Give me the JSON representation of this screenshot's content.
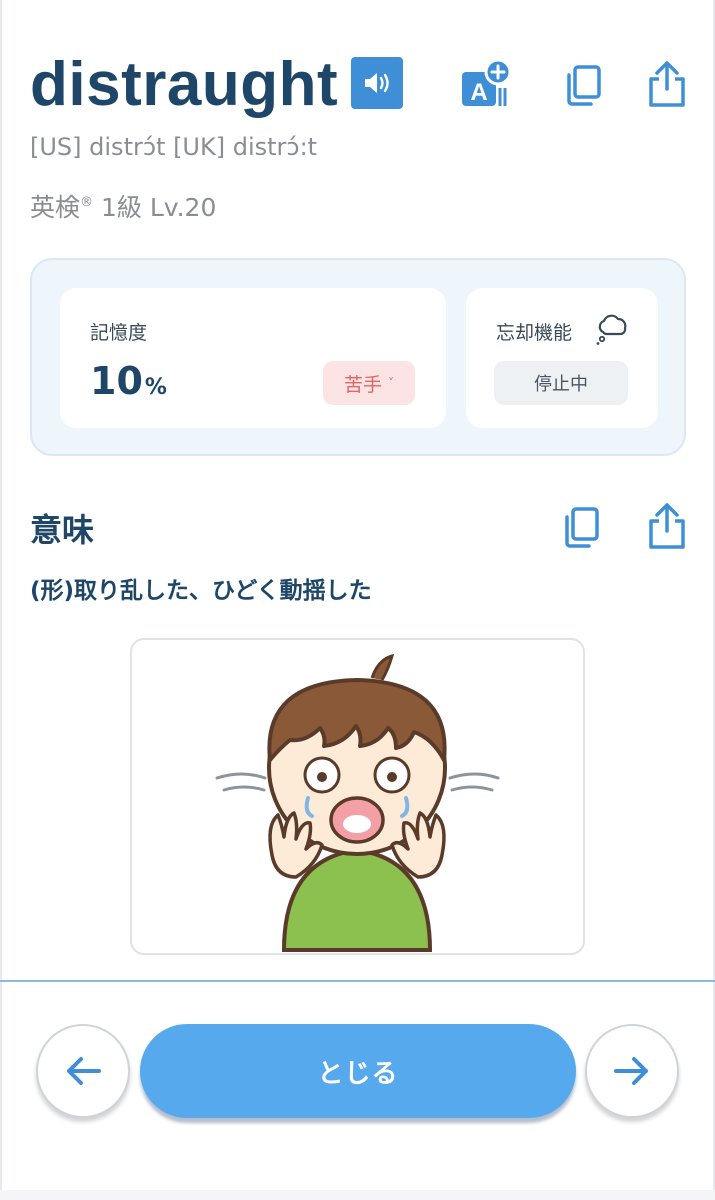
{
  "header": {
    "word": "distraught",
    "pronunciation": "[US] distrɔ́t [UK] distrɔ́:t",
    "level_prefix": "英検",
    "level_mark": "®",
    "level_rest": " 1級 Lv.20"
  },
  "memory": {
    "label": "記憶度",
    "value": "10",
    "unit": "%",
    "status_label": "苦手",
    "status_chevron": "˅"
  },
  "forget": {
    "label": "忘却機能",
    "status": "停止中"
  },
  "meaning": {
    "title": "意味",
    "definition": "(形)取り乱した、ひどく動揺した"
  },
  "footer": {
    "close_label": "とじる"
  },
  "colors": {
    "accent": "#3f8fd6",
    "button": "#56a9ec",
    "word": "#1e4668",
    "weak_bg": "#fde4e4",
    "weak_text": "#e06565"
  },
  "icons": {
    "speaker": "speaker-icon",
    "translate": "translate-add-icon",
    "copy": "copy-icon",
    "share": "share-icon",
    "cloud": "thought-cloud-icon",
    "prev": "arrow-left-icon",
    "next": "arrow-right-icon"
  }
}
